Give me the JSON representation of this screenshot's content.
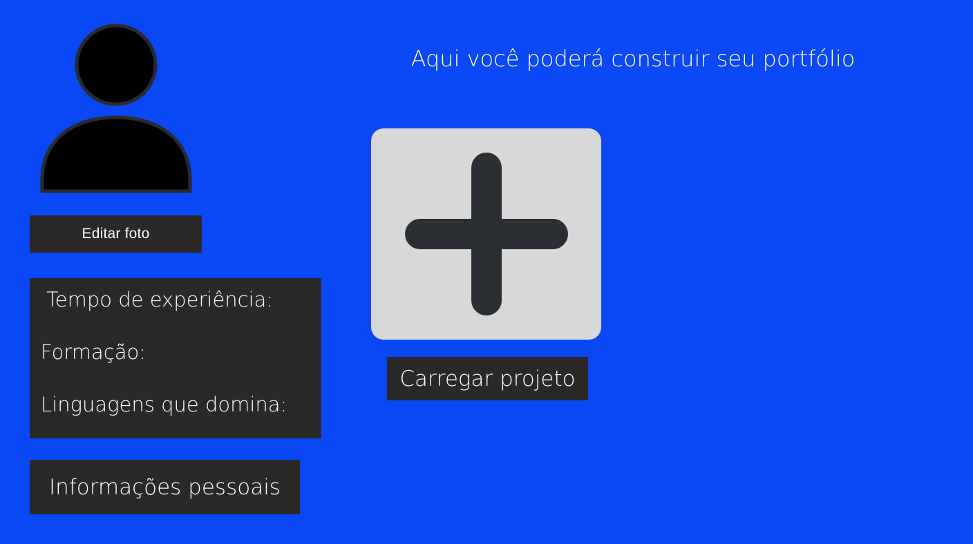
{
  "page": {
    "background_color": "#0a48f5"
  },
  "profile": {
    "avatar_icon": "user-silhouette-icon",
    "edit_photo_label": "Editar foto"
  },
  "info_panel": {
    "experience_label": "Tempo de experiência:",
    "education_label": "Formação:",
    "languages_label": "Linguagens que domina:"
  },
  "personal_info_button": {
    "label": "Informações pessoais"
  },
  "portfolio": {
    "headline": "Aqui você poderá construir seu portfólio",
    "add_icon": "plus-icon",
    "upload_label": "Carregar projeto"
  },
  "colors": {
    "panel": "#2a2927",
    "card": "#d8d8d8",
    "icon": "#2b2e32",
    "text": "#ffffff"
  }
}
